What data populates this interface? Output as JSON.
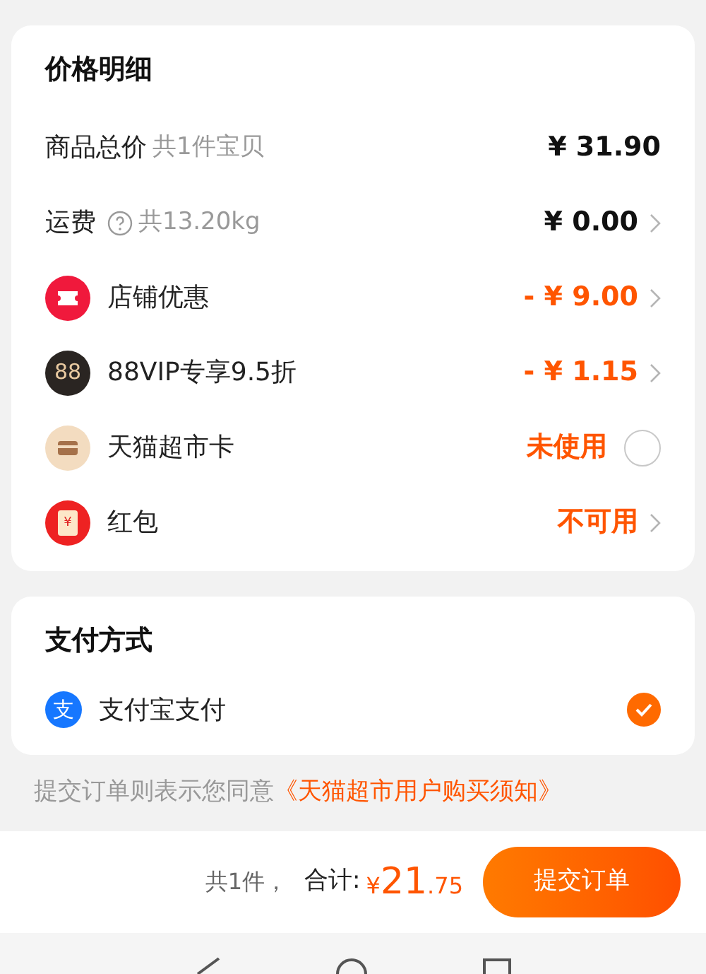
{
  "price_detail": {
    "title": "价格明细",
    "rows": [
      {
        "kind": "total",
        "label": "商品总价",
        "note": "共1件宝贝",
        "value": "¥ 31.90",
        "highlight": false
      },
      {
        "kind": "shipping",
        "label": "运费",
        "note": "共13.20kg",
        "value": "¥ 0.00",
        "highlight": false
      },
      {
        "kind": "coupon",
        "label": "店铺优惠",
        "value": "- ¥ 9.00",
        "highlight": true
      },
      {
        "kind": "vip",
        "icon_text": "88",
        "label": "88VIP专享9.5折",
        "value": "- ¥ 1.15",
        "highlight": true
      },
      {
        "kind": "card",
        "label": "天猫超市卡",
        "value": "未使用",
        "highlight": true,
        "checked": false
      },
      {
        "kind": "packet",
        "icon_text": "¥",
        "label": "红包",
        "value": "不可用",
        "highlight": true
      }
    ]
  },
  "payment": {
    "title": "支付方式",
    "methods": [
      {
        "icon_text": "支",
        "label": "支付宝支付",
        "checked": true
      }
    ]
  },
  "agreement": {
    "text": "提交订单则表示您同意",
    "link": "《天猫超市用户购买须知》"
  },
  "bottom_bar": {
    "count": "共1件，",
    "total_label": "合计:",
    "currency": "¥",
    "total_int": "21",
    "total_dec": ".75",
    "submit": "提交订单"
  }
}
